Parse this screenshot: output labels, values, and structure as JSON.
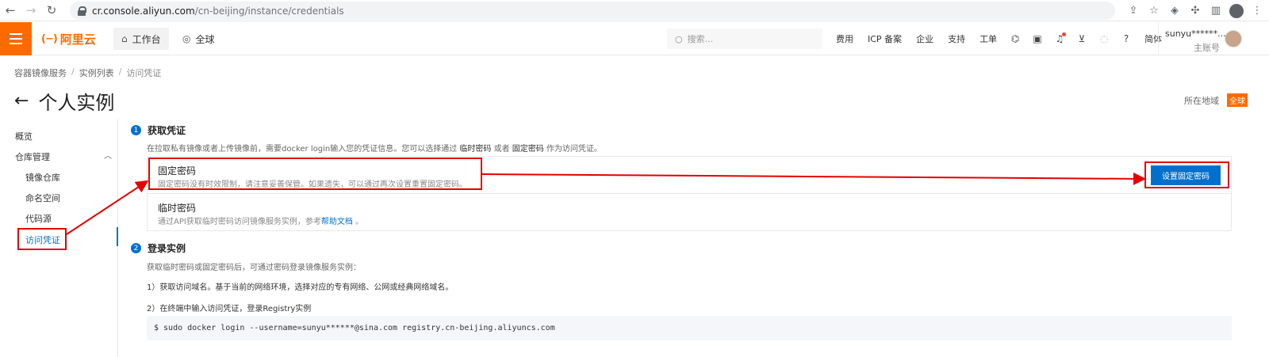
{
  "browser": {
    "url_host": "cr.console.aliyun.com",
    "url_path": "/cn-beijing/instance/credentials"
  },
  "topbar": {
    "logo_text": "阿里云",
    "workbench": "工作台",
    "global": "全球",
    "search_placeholder": "搜索...",
    "links": [
      "费用",
      "ICP 备案",
      "企业",
      "支持",
      "工单"
    ],
    "lang": "简体",
    "user_name": "sunyu******...",
    "user_role": "主账号"
  },
  "breadcrumb": {
    "items": [
      "容器镜像服务",
      "实例列表",
      "访问凭证"
    ]
  },
  "page": {
    "title": "个人实例",
    "region_label": "所在地域",
    "region_value": "全球"
  },
  "sidebar": {
    "overview": "概览",
    "repo_group": "仓库管理",
    "items": [
      "镜像仓库",
      "命名空间",
      "代码源",
      "访问凭证"
    ]
  },
  "step1": {
    "num": "1",
    "title": "获取凭证",
    "desc_a": "在拉取私有镜像或者上传镜像前，需要docker login输入您的凭证信息。您可以选择通过 ",
    "desc_b": "临时密码",
    "desc_c": " 或者 ",
    "desc_d": "固定密码",
    "desc_e": " 作为访问凭证。",
    "fixed_title": "固定密码",
    "fixed_desc": "固定密码没有时效限制，请注意妥善保管。如果遗失，可以通过再次设置重置固定密码。",
    "set_button": "设置固定密码",
    "temp_title": "临时密码",
    "temp_desc_a": "通过API获取临时密码访问镜像服务实例，参考",
    "temp_link": "帮助文档",
    "temp_desc_b": " 。"
  },
  "step2": {
    "num": "2",
    "title": "登录实例",
    "desc": "获取临时密码或固定密码后，可通过密码登录镜像服务实例：",
    "line1": "1）获取访问域名。基于当前的网络环境，选择对应的专有网络、公网或经典网络域名。",
    "line2": "2）在终端中输入访问凭证，登录Registry实例",
    "command": "$ sudo docker login --username=sunyu******@sina.com registry.cn-beijing.aliyuncs.com"
  },
  "colors": {
    "brand": "#ff6a00",
    "primary": "#0070cc",
    "annotation": "#e50000"
  }
}
